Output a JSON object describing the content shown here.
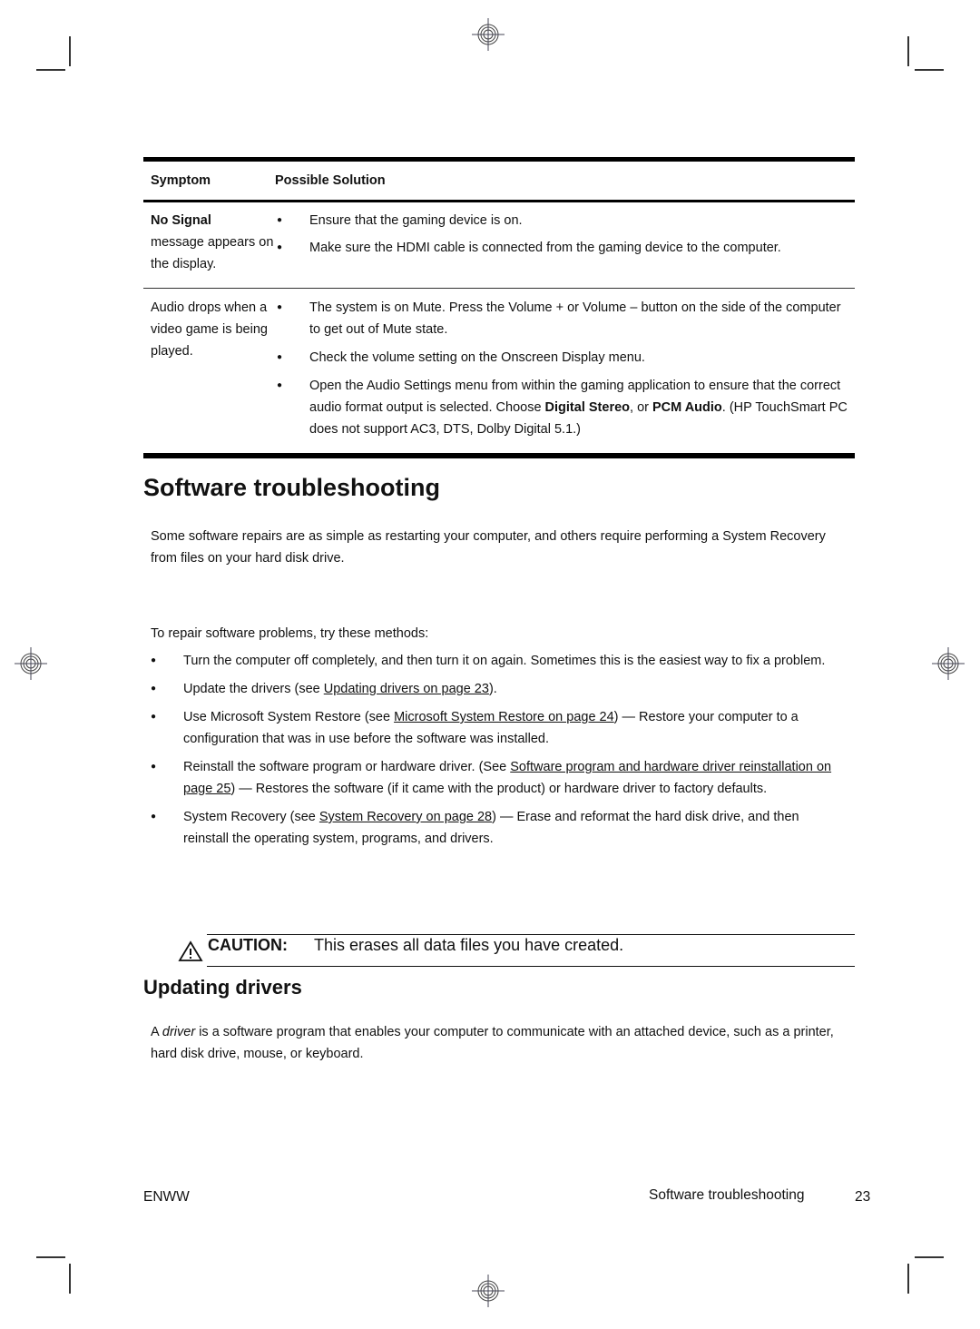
{
  "table": {
    "headers": {
      "symptom": "Symptom",
      "solution": "Possible Solution"
    },
    "rows": [
      {
        "symptom_bold": "No Signal",
        "symptom_rest": "message appears on the display.",
        "solutions": [
          "Ensure that the gaming device is on.",
          "Make sure the HDMI cable is connected from the gaming device to the computer."
        ]
      },
      {
        "symptom_bold": "",
        "symptom_rest": "Audio drops when a video game is being played.",
        "solutions": [
          "The system is on Mute. Press the Volume + or Volume – button on the side of the computer to get out of Mute state.",
          "Check the volume setting on the Onscreen Display menu.",
          {
            "pre": "Open the Audio Settings menu from within the gaming application to ensure that the correct audio format output is selected. Choose ",
            "bold1": "Digital Stereo",
            "mid": ", or ",
            "bold2": "PCM Audio",
            "post": ". (HP TouchSmart PC does not support AC3, DTS, Dolby Digital 5.1.)"
          }
        ]
      }
    ]
  },
  "section1": {
    "title": "Software troubleshooting",
    "intro": "Some software repairs are as simple as restarting your computer, and others require performing a System Recovery from files on your hard disk drive.",
    "lead": "To repair software problems, try these methods:",
    "methods": [
      {
        "pre": "Turn the computer off completely, and then turn it on again. Sometimes this is the easiest way to fix a problem.",
        "link": "",
        "post": ""
      },
      {
        "pre": "Update the drivers (see ",
        "link": "Updating drivers on page 23",
        "post": ")."
      },
      {
        "pre": "Use Microsoft System Restore (see ",
        "link": "Microsoft System Restore on page 24",
        "post": ") — Restore your computer to a configuration that was in use before the software was installed."
      },
      {
        "pre": "Reinstall the software program or hardware driver. (See ",
        "link": "Software program and hardware driver reinstallation on page 25",
        "post": ") — Restores the software (if it came with the product) or hardware driver to factory defaults."
      },
      {
        "pre": "System Recovery (see ",
        "link": "System Recovery on page 28",
        "post": ") — Erase and reformat the hard disk drive, and then reinstall the operating system, programs, and drivers."
      }
    ],
    "caution": {
      "label": "CAUTION:",
      "message": "This erases all data files you have created."
    }
  },
  "section2": {
    "title": "Updating drivers",
    "body_pre": "A ",
    "body_em": "driver",
    "body_post": " is a software program that enables your computer to communicate with an attached device, such as a printer, hard disk drive, mouse, or keyboard."
  },
  "footer": {
    "left": "ENWW",
    "section": "Software troubleshooting",
    "page": "23"
  },
  "bullet": "●"
}
